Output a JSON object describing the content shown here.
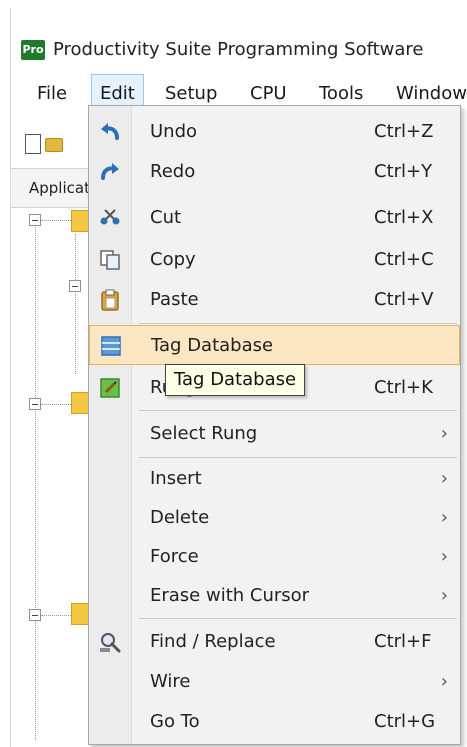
{
  "app": {
    "logo_text": "Pro",
    "title": "Productivity Suite Programming Software"
  },
  "menubar": [
    {
      "label": "File",
      "active": false
    },
    {
      "label": "Edit",
      "active": true
    },
    {
      "label": "Setup",
      "active": false
    },
    {
      "label": "CPU",
      "active": false
    },
    {
      "label": "Tools",
      "active": false
    },
    {
      "label": "Window",
      "active": false
    }
  ],
  "sidebar": {
    "tab_label": "Application"
  },
  "edit_menu": {
    "items": [
      {
        "label": "Undo",
        "shortcut": "Ctrl+Z",
        "icon": "undo-icon"
      },
      {
        "label": "Redo",
        "shortcut": "Ctrl+Y",
        "icon": "redo-icon"
      },
      {
        "label": "Cut",
        "shortcut": "Ctrl+X",
        "icon": "cut-icon"
      },
      {
        "label": "Copy",
        "shortcut": "Ctrl+C",
        "icon": "copy-icon"
      },
      {
        "label": "Paste",
        "shortcut": "Ctrl+V",
        "icon": "paste-icon"
      },
      {
        "label": "Tag Database",
        "shortcut": "",
        "icon": "tag-database-icon",
        "highlighted": true
      },
      {
        "label": "Rung Comment",
        "shortcut": "Ctrl+K",
        "icon": "rung-comment-icon"
      },
      {
        "label": "Select Rung",
        "submenu": true
      },
      {
        "label": "Insert",
        "submenu": true
      },
      {
        "label": "Delete",
        "submenu": true
      },
      {
        "label": "Force",
        "submenu": true
      },
      {
        "label": "Erase with Cursor",
        "submenu": true
      },
      {
        "label": "Find / Replace",
        "shortcut": "Ctrl+F",
        "icon": "find-replace-icon"
      },
      {
        "label": "Wire",
        "submenu": true
      },
      {
        "label": "Go To",
        "shortcut": "Ctrl+G"
      }
    ],
    "submenu_arrow": "›"
  },
  "tooltip": {
    "text": "Tag Database"
  },
  "colors": {
    "highlight_bg": "#fde6c2",
    "highlight_border": "#e5b062",
    "menu_bg": "#f2f2f2",
    "active_menu_bg": "#e5f1fb",
    "folder": "#f5c842",
    "logo": "#1f7a2e"
  }
}
